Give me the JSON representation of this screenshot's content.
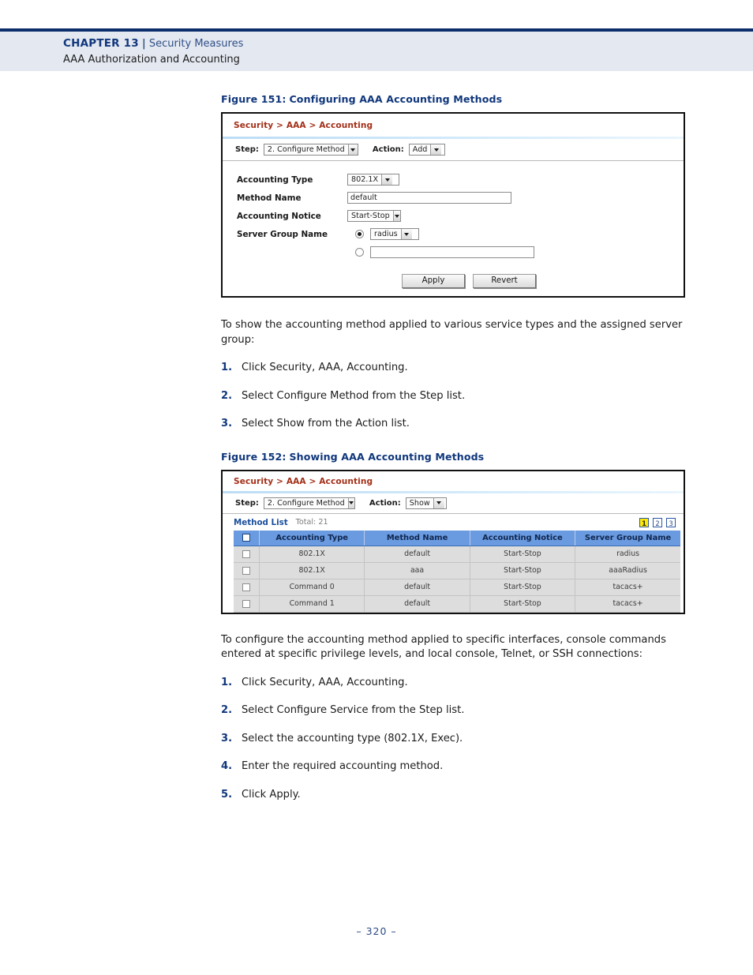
{
  "header": {
    "chapter_label": "CHAPTER 13",
    "chapter_label_caps": "C",
    "chapter_label_rest": "HAPTER",
    "chapter_number": "13",
    "separator": "|",
    "chapter_title": "Security Measures",
    "section_title": "AAA Authorization and Accounting"
  },
  "figure151": {
    "caption_number": "Figure 151:",
    "caption_text": "Configuring AAA Accounting Methods",
    "breadcrumb": "Security > AAA > Accounting",
    "step_label": "Step:",
    "step_value": "2. Configure Method",
    "action_label": "Action:",
    "action_value": "Add",
    "fields": [
      {
        "label": "Accounting Type",
        "value": "802.1X"
      },
      {
        "label": "Method Name",
        "value": "default"
      },
      {
        "label": "Accounting Notice",
        "value": "Start-Stop"
      },
      {
        "label": "Server Group Name",
        "value": "radius"
      }
    ],
    "server_group_custom_value": "",
    "apply_label": "Apply",
    "revert_label": "Revert"
  },
  "body1": {
    "paragraph": "To show the accounting method applied to various service types and the assigned server group:",
    "steps": [
      {
        "num": "1.",
        "text": "Click Security, AAA, Accounting."
      },
      {
        "num": "2.",
        "text": "Select Configure Method from the Step list."
      },
      {
        "num": "3.",
        "text": "Select Show from the Action list."
      }
    ]
  },
  "figure152": {
    "caption_number": "Figure 152:",
    "caption_text": "Showing AAA Accounting Methods",
    "breadcrumb": "Security > AAA > Accounting",
    "step_label": "Step:",
    "step_value": "2. Configure Method",
    "action_label": "Action:",
    "action_value": "Show",
    "list_title": "Method List",
    "list_total": "Total: 21",
    "pages": [
      "1",
      "2",
      "3"
    ],
    "active_page": "1",
    "columns": [
      "",
      "Accounting Type",
      "Method Name",
      "Accounting Notice",
      "Server Group Name"
    ],
    "rows": [
      {
        "type": "802.1X",
        "method": "default",
        "notice": "Start-Stop",
        "group": "radius"
      },
      {
        "type": "802.1X",
        "method": "aaa",
        "notice": "Start-Stop",
        "group": "aaaRadius"
      },
      {
        "type": "Command 0",
        "method": "default",
        "notice": "Start-Stop",
        "group": "tacacs+"
      },
      {
        "type": "Command 1",
        "method": "default",
        "notice": "Start-Stop",
        "group": "tacacs+"
      }
    ]
  },
  "body2": {
    "paragraph": "To configure the accounting method applied to specific interfaces, console commands entered at specific privilege levels, and local console, Telnet, or SSH connections:",
    "steps": [
      {
        "num": "1.",
        "text": "Click Security, AAA, Accounting."
      },
      {
        "num": "2.",
        "text": "Select Configure Service from the Step list."
      },
      {
        "num": "3.",
        "text": "Select the accounting type (802.1X, Exec)."
      },
      {
        "num": "4.",
        "text": "Enter the required accounting method."
      },
      {
        "num": "5.",
        "text": "Click Apply."
      }
    ]
  },
  "footer": {
    "page_number": "–  320  –"
  },
  "colors": {
    "header_band": "#e4e8f1",
    "navy_rule": "#0b2d6b",
    "caption_blue": "#10377c",
    "breadcrumb_red": "#a33018",
    "table_header_blue": "#6a9ae0",
    "page_active_yellow": "#ffe900"
  }
}
